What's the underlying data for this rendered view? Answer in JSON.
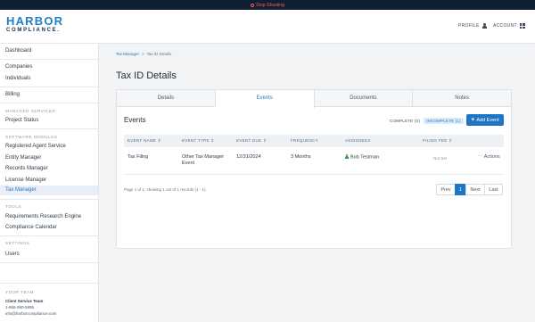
{
  "ghost_bar": {
    "label": "Stop Ghosting"
  },
  "header": {
    "logo_top": "HARBOR",
    "logo_bottom": "COMPLIANCE.",
    "profile_label": "PROFILE",
    "account_label": "ACCOUNT"
  },
  "sidebar": {
    "dashboard": "Dashboard",
    "companies": "Companies",
    "individuals": "Individuals",
    "billing": "Billing",
    "managed_services_head": "MANAGED SERVICES",
    "project_status": "Project Status",
    "software_modules_head": "SOFTWARE MODULES",
    "registered_agent": "Registered Agent Service",
    "entity_manager": "Entity Manager",
    "records_manager": "Records Manager",
    "license_manager": "License Manager",
    "tax_manager": "Tax Manager",
    "tools_head": "TOOLS",
    "research_engine": "Requirements Research Engine",
    "compliance_calendar": "Compliance Calendar",
    "settings_head": "SETTINGS",
    "users": "Users",
    "your_team_head": "YOUR TEAM",
    "team_name": "Client Service Team",
    "team_phone": "1-866-990-5895",
    "team_email": "info@harborcompliance.com"
  },
  "breadcrumb": {
    "parent": "Tax Manager",
    "separator": ">",
    "current": "Tax ID Details"
  },
  "page_title": "Tax ID Details",
  "tabs": [
    "Details",
    "Events",
    "Documents",
    "Notes"
  ],
  "events": {
    "title": "Events",
    "filter_complete": "COMPLETE (0)",
    "filter_incomplete": "INCOMPLETE (1)",
    "add_button": "Add Event",
    "columns": [
      "EVENT NAME",
      "EVENT TYPE",
      "EVENT DUE",
      "FREQUENCY",
      "ASSIGNEES",
      "FILING FEE"
    ],
    "rows": [
      {
        "event_name": "Tax Filing",
        "event_type": "Other Tax Manager Event",
        "event_due": "12/31/2024",
        "frequency": "3 Months",
        "assignee": "Bob Testman",
        "filing_fee": "Not Set",
        "actions": "Actions"
      }
    ],
    "pagination_info": "Page 1 of 1, showing 1 out of 1 records (1 - 1).",
    "pager": {
      "prev": "Prev",
      "current": "1",
      "next": "Next",
      "last": "Last"
    }
  }
}
